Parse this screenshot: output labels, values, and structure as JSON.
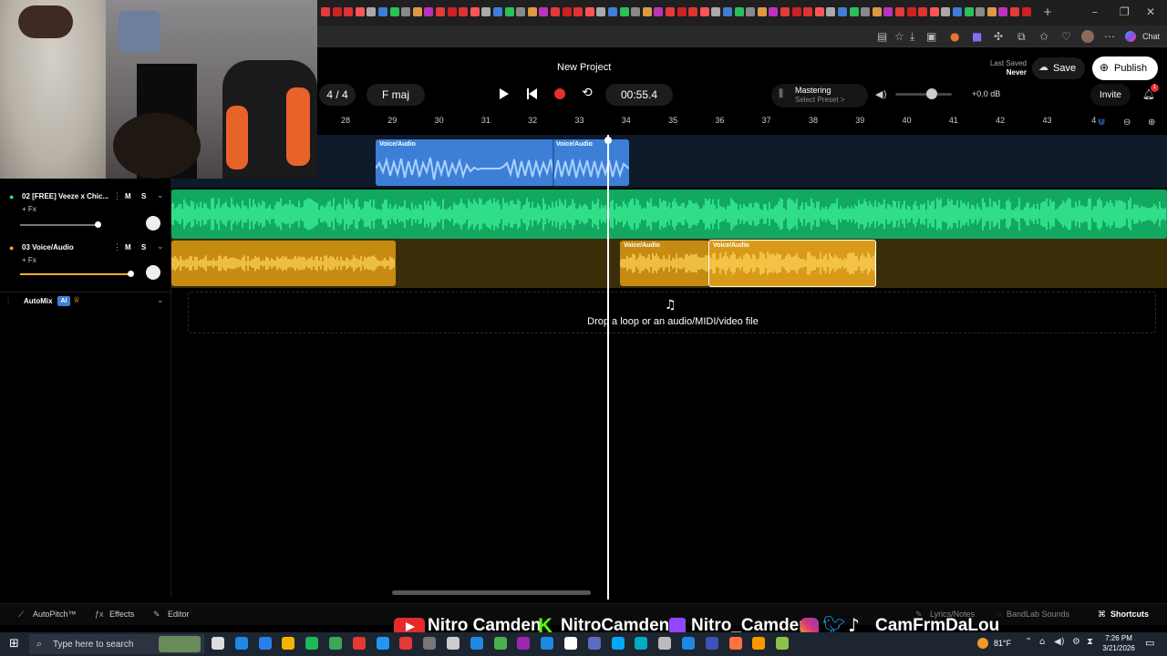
{
  "header": {
    "project_title": "New Project",
    "time_signature": "4 / 4",
    "key": "F maj",
    "time": "00:55.4",
    "mastering_label": "Mastering",
    "mastering_preset": "Select Preset >",
    "volume_db": "+0.0 dB",
    "last_saved_label": "Last Saved",
    "last_saved_value": "Never",
    "save_label": "Save",
    "publish_label": "Publish",
    "invite_label": "Invite",
    "notification_count": "1",
    "chat_label": "Chat"
  },
  "ruler": {
    "ticks": [
      "28",
      "29",
      "30",
      "31",
      "32",
      "33",
      "34",
      "35",
      "36",
      "37",
      "38",
      "39",
      "40",
      "41",
      "42",
      "43",
      "4"
    ]
  },
  "tracks": [
    {
      "name": "02  [FREE] Veeze x Chic...",
      "fx": "+ Fx",
      "mute": "M",
      "solo": "S",
      "color": "#2ee07f"
    },
    {
      "name": "03  Voice/Audio",
      "fx": "+ Fx",
      "mute": "M",
      "solo": "S",
      "color": "#f0b020"
    }
  ],
  "automix": {
    "label": "AutoMix",
    "badge": "AI"
  },
  "clips": {
    "top_a": "Voice/Audio",
    "top_b": "Voice/Audio",
    "yellow_a": "Voice/Audio",
    "yellow_b": "Voice/Audio"
  },
  "dropzone_text": "Drop a loop or an audio/MIDI/video file",
  "bottom": {
    "autopitch": "AutoPitch™",
    "effects": "Effects",
    "editor": "Editor",
    "lyrics": "Lyrics/Notes",
    "sounds": "BandLab Sounds",
    "shortcuts": "Shortcuts"
  },
  "overlay": {
    "youtube": "Nitro Camden",
    "kick": "NitroCamden",
    "twitch": "Nitro_Camden",
    "socials": "CamFrmDaLou"
  },
  "taskbar": {
    "search_placeholder": "Type here to search",
    "temperature": "81°F",
    "time": "7:26 PM",
    "date": "3/21/2026"
  },
  "colors": {
    "accent_blue": "#3d7fd6",
    "track_green": "#2ee07f",
    "track_yellow": "#f0b020",
    "record_red": "#e53030"
  }
}
